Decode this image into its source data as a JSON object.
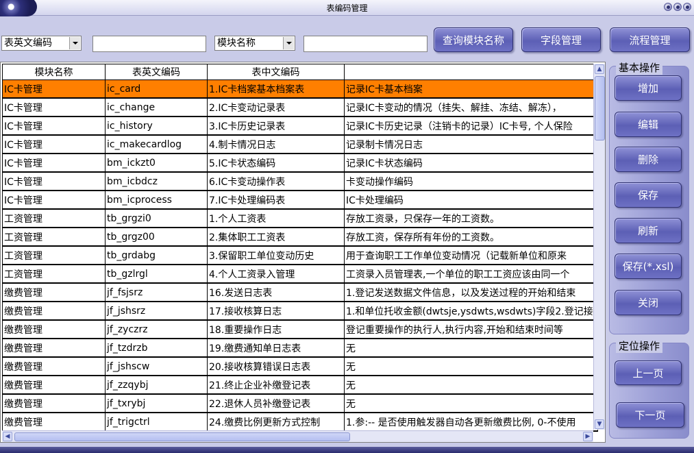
{
  "window": {
    "title": "表编码管理"
  },
  "toolbar": {
    "select1_value": "表英文编码",
    "select2_value": "模块名称",
    "query_module_button": "查询模块名称",
    "field_manage_button": "字段管理",
    "flow_manage_button": "流程管理"
  },
  "grid": {
    "columns": [
      "模块名称",
      "表英文编码",
      "表中文编码",
      ""
    ],
    "rows": [
      [
        "IC卡管理",
        "ic_card",
        "1.IC卡档案基本档案表",
        "记录IC卡基本档案"
      ],
      [
        "IC卡管理",
        "ic_change",
        "2.IC卡变动记录表",
        "记录IC卡变动的情况（挂失、解挂、冻结、解冻），"
      ],
      [
        "IC卡管理",
        "ic_history",
        "3.IC卡历史记录表",
        "记录IC卡历史记录（注销卡的记录）IC卡号, 个人保险"
      ],
      [
        "IC卡管理",
        "ic_makecardlog",
        "4.制卡情况日志",
        "记录制卡情况日志"
      ],
      [
        "IC卡管理",
        "bm_ickzt0",
        "5.IC卡状态编码",
        "记录IC卡状态编码"
      ],
      [
        "IC卡管理",
        "bm_icbdcz",
        "6.IC卡变动操作表",
        "卡变动操作编码"
      ],
      [
        "IC卡管理",
        "bm_icprocess",
        "7.IC卡处理编码表",
        "IC卡处理编码"
      ],
      [
        "工资管理",
        "tb_grgzi0",
        "1.个人工资表",
        "存放工资录，只保存一年的工资数。"
      ],
      [
        "工资管理",
        "tb_grgz00",
        "2.集体职工工资表",
        "存放工资，保存所有年份的工资数。"
      ],
      [
        "工资管理",
        "tb_grdabg",
        "3.保留职工单位变动历史",
        "用于查询职工工作单位变动情况（记载新单位和原来"
      ],
      [
        "工资管理",
        "tb_gzlrgl",
        "4.个人工资录入管理",
        "工资录入员管理表,一个单位的职工工资应该由同一个"
      ],
      [
        "缴费管理",
        "jf_fsjsrz",
        "16.发送日志表",
        "1.登记发送数据文件信息，以及发送过程的开始和结束"
      ],
      [
        "缴费管理",
        "jf_jshsrz",
        "17.接收核算日志",
        "1.和单位托收金额(dwtsje,ysdwts,wsdwts)字段2.登记接"
      ],
      [
        "缴费管理",
        "jf_zyczrz",
        "18.重要操作日志",
        "登记重要操作的执行人,执行内容,开始和结束时间等"
      ],
      [
        "缴费管理",
        "jf_tzdrzb",
        "19.缴费通知单日志表",
        "无"
      ],
      [
        "缴费管理",
        "jf_jshscw",
        "20.接收核算错误日志表",
        "无"
      ],
      [
        "缴费管理",
        "jf_zzqybj",
        "21.终止企业补缴登记表",
        "无"
      ],
      [
        "缴费管理",
        "jf_txrybj",
        "22.退休人员补缴登记表",
        "无"
      ],
      [
        "缴费管理",
        "jf_trigctrl",
        "24.缴费比例更新方式控制",
        "1.参:-- 是否使用触发器自动各更新缴费比例, 0-不使用"
      ]
    ]
  },
  "basic_ops": {
    "title": "基本操作",
    "add": "增加",
    "edit": "编辑",
    "delete": "删除",
    "save": "保存",
    "refresh": "刷新",
    "save_xsl": "保存(*.xsl)",
    "close": "关闭"
  },
  "nav_ops": {
    "title": "定位操作",
    "prev_page": "上一页",
    "next_page": "下一页"
  }
}
